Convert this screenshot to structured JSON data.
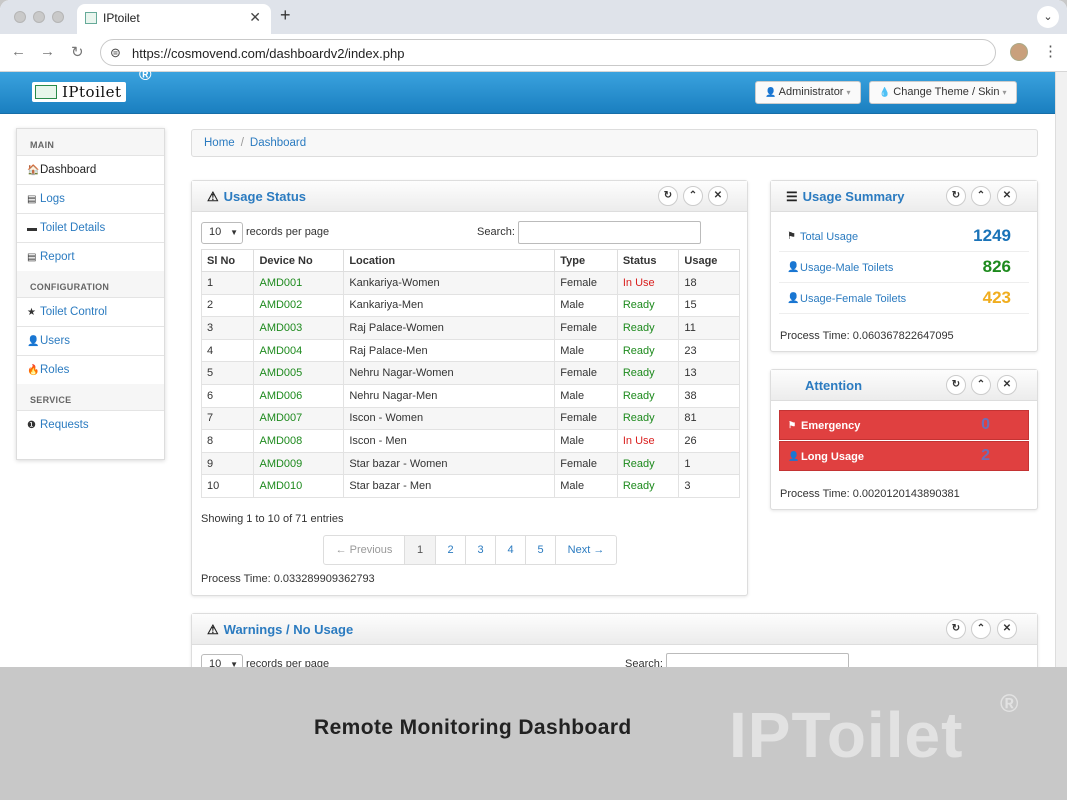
{
  "browser": {
    "tab_title": "IPtoilet",
    "tab_close": "✕",
    "new_tab": "+",
    "tab_menu": "⌄",
    "url": "https://cosmovend.com/dashboardv2/index.php",
    "back": "←",
    "forward": "→",
    "reload": "↻",
    "site_info": "⊜",
    "kebab": "⋮"
  },
  "header": {
    "logo_text": "IPtoilet",
    "registered": "®",
    "admin_label": "Administrator",
    "theme_label": "Change Theme / Skin",
    "caret": "▾",
    "user_icon": "👤",
    "drop_icon": "💧"
  },
  "sidebar": {
    "sections": [
      {
        "title": "MAIN",
        "items": [
          {
            "label": "Dashboard",
            "icon": "🏠",
            "icon_name": "home-icon",
            "active": true
          },
          {
            "label": "Logs",
            "icon": "▤",
            "icon_name": "list-icon"
          },
          {
            "label": "Toilet Details",
            "icon": "▬",
            "icon_name": "toilet-icon"
          },
          {
            "label": "Report",
            "icon": "▤",
            "icon_name": "report-icon"
          }
        ]
      },
      {
        "title": "CONFIGURATION",
        "items": [
          {
            "label": "Toilet Control",
            "icon": "★",
            "icon_name": "star-icon"
          },
          {
            "label": "Users",
            "icon": "👤",
            "icon_name": "user-icon"
          },
          {
            "label": "Roles",
            "icon": "🔥",
            "icon_name": "fire-icon"
          }
        ]
      },
      {
        "title": "SERVICE",
        "items": [
          {
            "label": "Requests",
            "icon": "❶",
            "icon_name": "exclamation-icon"
          }
        ]
      }
    ]
  },
  "breadcrumb": {
    "home": "Home",
    "sep": "/",
    "current": "Dashboard"
  },
  "usage_status": {
    "title": "Usage Status",
    "title_icon": "⚠",
    "records_value": "10",
    "records_label": "records per page",
    "search_label": "Search:",
    "columns": [
      "Sl No",
      "Device No",
      "Location",
      "Type",
      "Status",
      "Usage"
    ],
    "rows": [
      [
        "1",
        "AMD001",
        "Kankariya-Women",
        "Female",
        "In Use",
        "18"
      ],
      [
        "2",
        "AMD002",
        "Kankariya-Men",
        "Male",
        "Ready",
        "15"
      ],
      [
        "3",
        "AMD003",
        "Raj Palace-Women",
        "Female",
        "Ready",
        "11"
      ],
      [
        "4",
        "AMD004",
        "Raj Palace-Men",
        "Male",
        "Ready",
        "23"
      ],
      [
        "5",
        "AMD005",
        "Nehru Nagar-Women",
        "Female",
        "Ready",
        "13"
      ],
      [
        "6",
        "AMD006",
        "Nehru Nagar-Men",
        "Male",
        "Ready",
        "38"
      ],
      [
        "7",
        "AMD007",
        "Iscon - Women",
        "Female",
        "Ready",
        "81"
      ],
      [
        "8",
        "AMD008",
        "Iscon - Men",
        "Male",
        "In Use",
        "26"
      ],
      [
        "9",
        "AMD009",
        "Star bazar - Women",
        "Female",
        "Ready",
        "1"
      ],
      [
        "10",
        "AMD010",
        "Star bazar - Men",
        "Male",
        "Ready",
        "3"
      ]
    ],
    "showing": "Showing 1 to 10 of 71 entries",
    "pager": [
      "← Previous",
      "1",
      "2",
      "3",
      "4",
      "5",
      "Next →"
    ],
    "process_time": "Process Time: 0.033289909362793"
  },
  "box_controls": {
    "refresh": "↻",
    "collapse": "⌃",
    "close": "✕"
  },
  "usage_summary": {
    "title": "Usage Summary",
    "title_icon": "☰",
    "items": [
      {
        "label": "Total Usage",
        "value": "1249",
        "color": "#1a73b8",
        "icon": "⚑"
      },
      {
        "label": "Usage-Male Toilets",
        "value": "826",
        "color": "#1d8a1d",
        "icon": "👤"
      },
      {
        "label": "Usage-Female Toilets",
        "value": "423",
        "color": "#f0ad1e",
        "icon": "👤"
      }
    ],
    "process_time": "Process Time: 0.060367822647095"
  },
  "attention": {
    "title": "Attention",
    "items": [
      {
        "label": "Emergency",
        "value": "0",
        "icon": "⚑"
      },
      {
        "label": "Long Usage",
        "value": "2",
        "icon": "👤"
      }
    ],
    "process_time": "Process Time: 0.0020120143890381"
  },
  "warnings": {
    "title": "Warnings / No Usage",
    "title_icon": "⚠",
    "records_value": "10",
    "records_label": "records per page",
    "search_label": "Search:"
  },
  "footer": {
    "caption": "Remote Monitoring Dashboard",
    "watermark": "IPToilet",
    "watermark_reg": "®"
  }
}
